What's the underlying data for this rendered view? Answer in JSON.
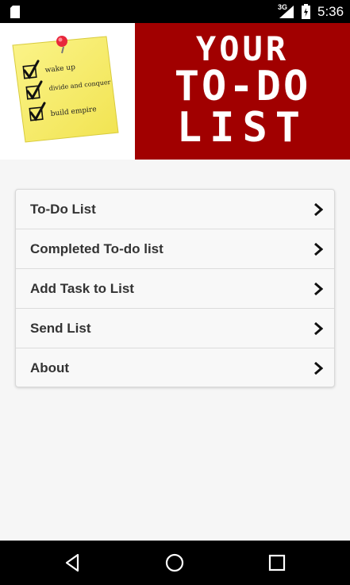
{
  "status_bar": {
    "network": "3G",
    "time": "5:36"
  },
  "banner": {
    "note_items": [
      "wake up",
      "divide and conquer",
      "build empire"
    ],
    "title_lines": [
      "YOUR",
      "TO-DO",
      "LIST"
    ],
    "colors": {
      "title_bg": "#a10000",
      "note": "#f8ef6a",
      "pin": "#e8273b"
    }
  },
  "menu": {
    "items": [
      {
        "label": "To-Do List",
        "icon": "chevron-right-icon"
      },
      {
        "label": "Completed To-do list",
        "icon": "chevron-right-icon"
      },
      {
        "label": "Add Task to List",
        "icon": "chevron-right-icon"
      },
      {
        "label": "Send List",
        "icon": "chevron-right-icon"
      },
      {
        "label": "About",
        "icon": "chevron-right-icon"
      }
    ]
  },
  "nav_bar": {
    "buttons": [
      "back-icon",
      "home-icon",
      "recents-icon"
    ]
  }
}
